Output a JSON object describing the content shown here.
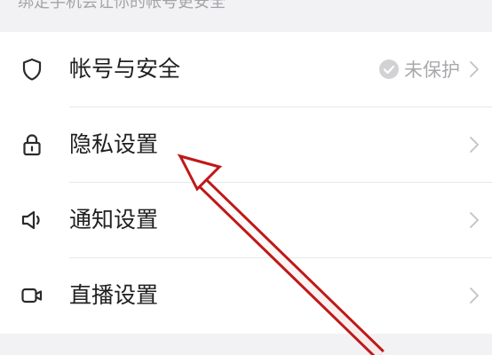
{
  "hint": {
    "text": "绑定手机会让你的帐号更安全"
  },
  "settings": {
    "items": [
      {
        "label": "帐号与安全",
        "icon": "shield-icon",
        "status": "未保护"
      },
      {
        "label": "隐私设置",
        "icon": "lock-icon"
      },
      {
        "label": "通知设置",
        "icon": "speaker-icon"
      },
      {
        "label": "直播设置",
        "icon": "video-camera-icon"
      }
    ]
  },
  "colors": {
    "annotation_arrow": "#c01818",
    "background": "#f2f2f4",
    "row_background": "#ffffff"
  }
}
